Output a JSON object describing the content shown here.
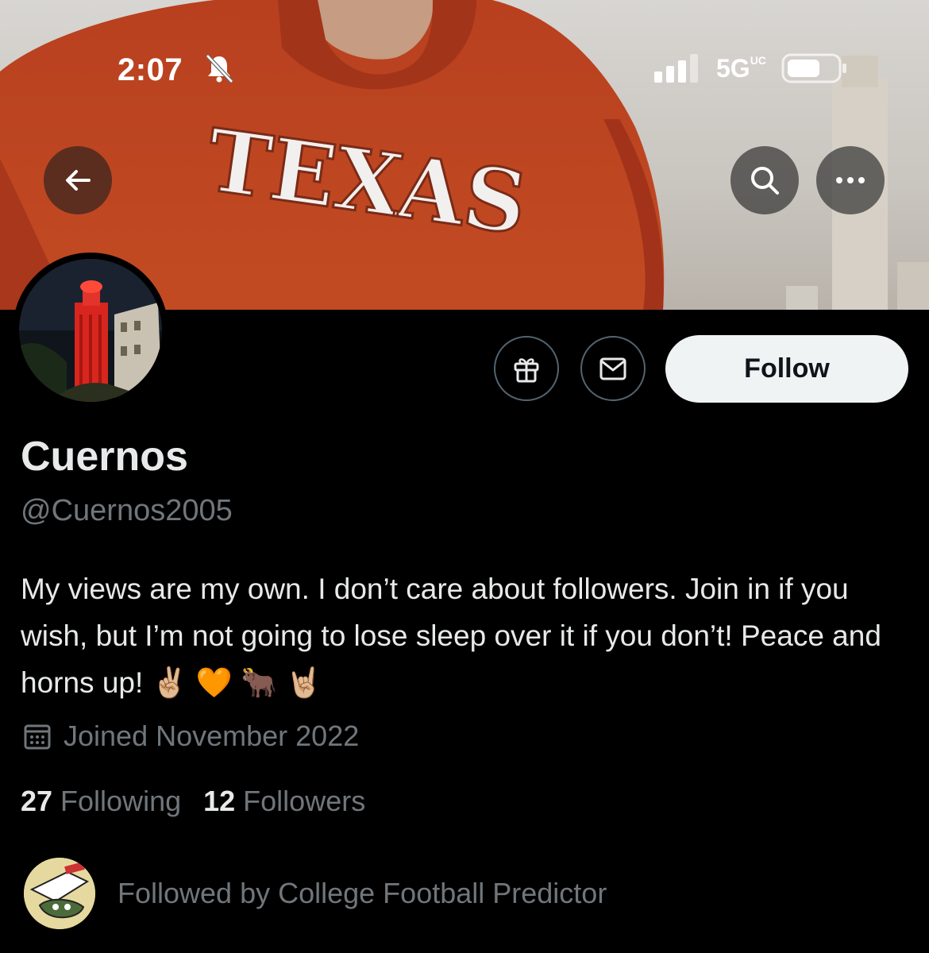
{
  "status_bar": {
    "time": "2:07",
    "network": "5G",
    "network_suffix": "UC"
  },
  "banner": {
    "shirt_text": "TEXAS"
  },
  "profile": {
    "display_name": "Cuernos",
    "handle": "@Cuernos2005",
    "bio": "My views are my own. I don’t care about followers. Join in if you wish, but I’m not going to lose sleep over it if you don’t! Peace and horns up! ✌🏼 🧡 🐂 🤘🏼",
    "joined": "Joined November 2022",
    "following_count": "27",
    "following_label": "Following",
    "followers_count": "12",
    "followers_label": "Followers",
    "followed_by": "Followed by College Football Predictor"
  },
  "actions": {
    "follow_label": "Follow"
  },
  "icons": {
    "back": "arrow-left-icon",
    "search": "search-icon",
    "more": "more-icon",
    "gift": "gift-icon",
    "mail": "mail-icon",
    "calendar": "calendar-icon",
    "bell": "bell-slash-icon"
  },
  "colors": {
    "follow_bg": "#eff3f4",
    "muted_text": "#71767b",
    "primary_text": "#e7e9ea",
    "background": "#000000"
  }
}
